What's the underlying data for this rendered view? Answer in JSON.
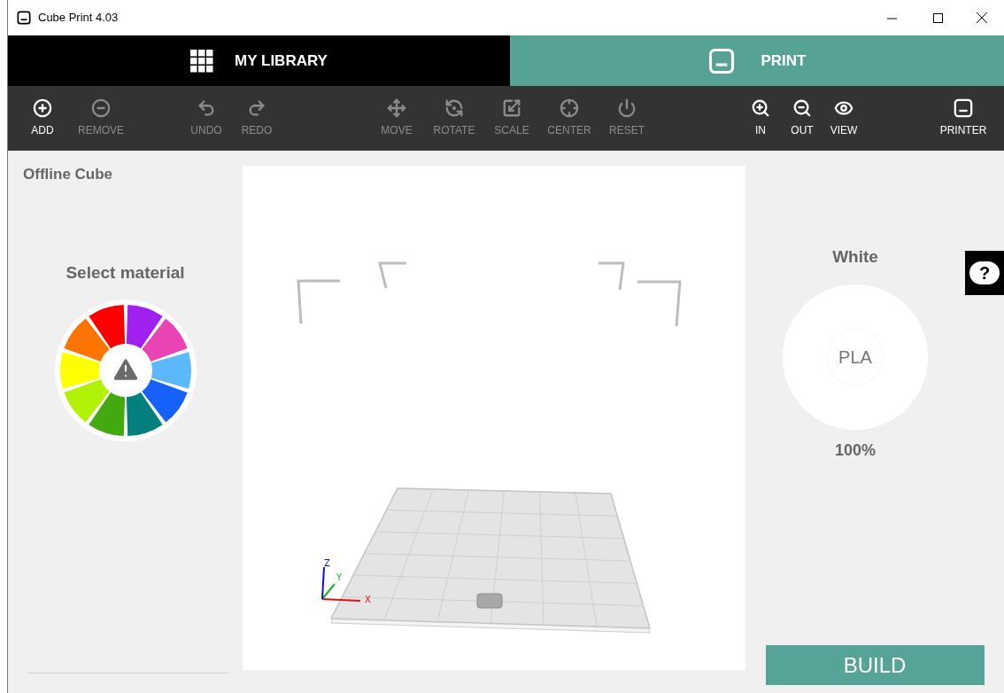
{
  "window": {
    "title": "Cube Print 4.03"
  },
  "tabs": [
    {
      "label": "MY LIBRARY",
      "selected": false
    },
    {
      "label": "PRINT",
      "selected": true
    }
  ],
  "toolbar": {
    "groups": [
      {
        "items": [
          {
            "label": "ADD",
            "disabled": false
          },
          {
            "label": "REMOVE",
            "disabled": true
          }
        ]
      },
      {
        "items": [
          {
            "label": "UNDO",
            "disabled": true
          },
          {
            "label": "REDO",
            "disabled": true
          }
        ]
      },
      {
        "items": [
          {
            "label": "MOVE",
            "disabled": true
          },
          {
            "label": "ROTATE",
            "disabled": true
          },
          {
            "label": "SCALE",
            "disabled": true
          },
          {
            "label": "CENTER",
            "disabled": true
          },
          {
            "label": "RESET",
            "disabled": true
          }
        ]
      },
      {
        "items": [
          {
            "label": "IN",
            "disabled": false
          },
          {
            "label": "OUT",
            "disabled": false
          },
          {
            "label": "VIEW",
            "disabled": false
          }
        ]
      },
      {
        "items": [
          {
            "label": "PRINTER",
            "disabled": false
          }
        ]
      }
    ]
  },
  "left_panel": {
    "printer_status": "Offline Cube",
    "material_heading": "Select material",
    "material_wheel": {
      "segments": [
        {
          "color": "#a020f0"
        },
        {
          "color": "#ea44b4"
        },
        {
          "color": "#5bb9fb"
        },
        {
          "color": "#1660fc"
        },
        {
          "color": "#01807d"
        },
        {
          "color": "#42aa0e"
        },
        {
          "color": "#b1f207"
        },
        {
          "color": "#ffff00"
        },
        {
          "color": "#ff7400"
        },
        {
          "color": "#ff0000"
        }
      ]
    }
  },
  "viewport": {
    "axes": [
      {
        "label": "X"
      },
      {
        "label": "Y"
      },
      {
        "label": "Z"
      }
    ]
  },
  "right_panel": {
    "color_name": "White",
    "material": "PLA",
    "amount": "100%",
    "help_button": {
      "label": "?"
    },
    "build_button": {
      "label": "BUILD"
    }
  }
}
